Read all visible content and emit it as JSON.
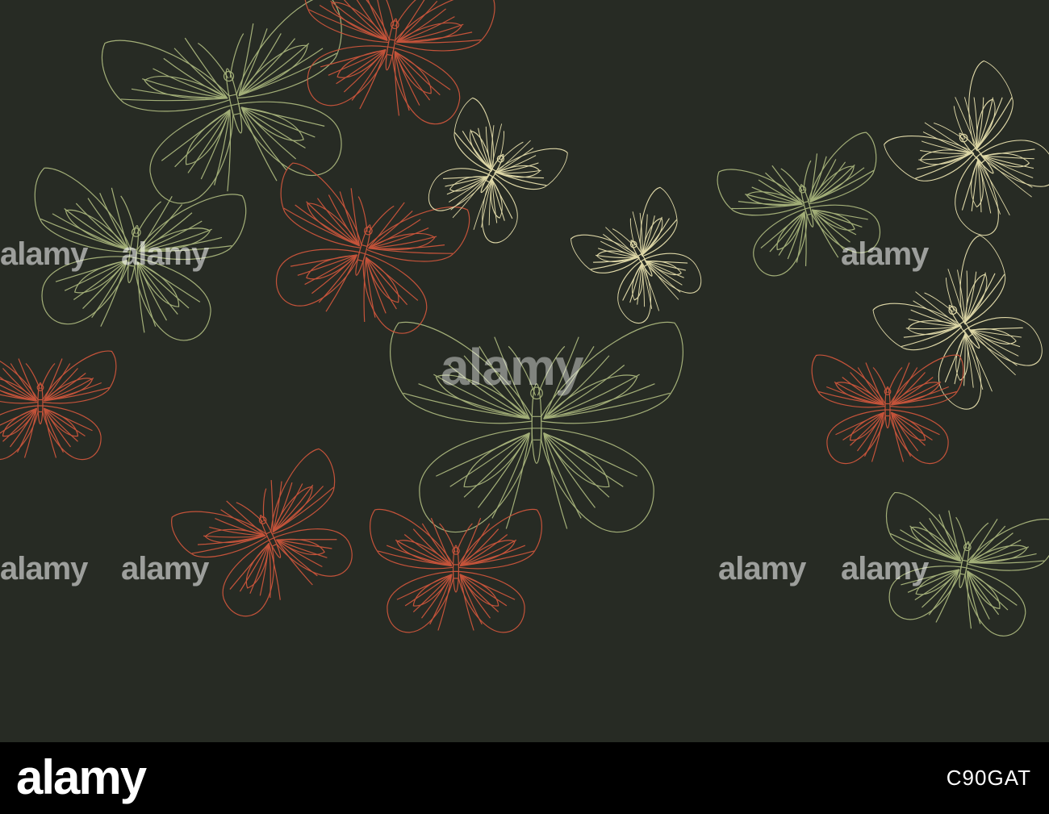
{
  "colors": {
    "background": "#272b24",
    "butterfly_green": "#a3af78",
    "butterfly_rust": "#c4533a",
    "butterfly_cream": "#dfd8a7",
    "footer": "#000000",
    "footer_text": "#ffffff"
  },
  "watermark": {
    "text": "alamy"
  },
  "footer": {
    "logo": "alamy",
    "image_id": "C90GAT"
  },
  "butterflies": [
    {
      "color": "green",
      "wings": "spread",
      "tilt": 0
    },
    {
      "color": "green",
      "wings": "spread",
      "tilt": -12
    },
    {
      "color": "rust",
      "wings": "spread",
      "tilt": 10
    },
    {
      "color": "green",
      "wings": "spread",
      "tilt": 8
    },
    {
      "color": "rust",
      "wings": "spread",
      "tilt": 15
    },
    {
      "color": "cream",
      "wings": "side",
      "tilt": 30
    },
    {
      "color": "green",
      "wings": "spread",
      "tilt": -15
    },
    {
      "color": "cream",
      "wings": "side",
      "tilt": -35
    },
    {
      "color": "rust",
      "wings": "spread",
      "tilt": 0
    },
    {
      "color": "cream",
      "wings": "side",
      "tilt": -30
    },
    {
      "color": "green",
      "wings": "spread",
      "tilt": 10
    },
    {
      "color": "rust",
      "wings": "spread",
      "tilt": 0
    },
    {
      "color": "rust",
      "wings": "spread",
      "tilt": -25
    },
    {
      "color": "cream",
      "wings": "side",
      "tilt": -40
    },
    {
      "color": "rust",
      "wings": "spread",
      "tilt": 0
    }
  ]
}
